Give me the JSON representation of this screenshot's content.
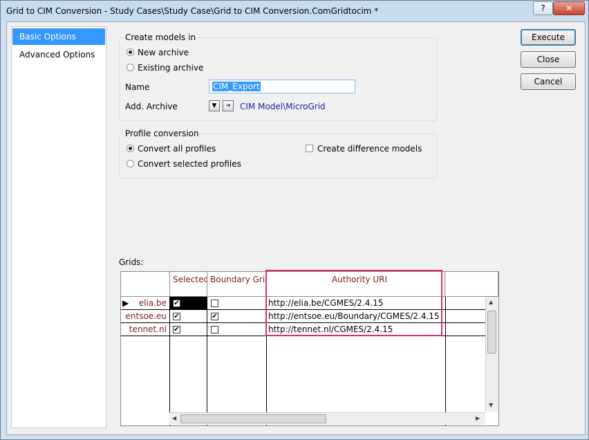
{
  "window": {
    "title": "Grid to CIM Conversion - Study Cases\\Study Case\\Grid to CIM Conversion.ComGridtocim *",
    "help_label": "?",
    "close_label": "✕"
  },
  "nav": {
    "items": [
      "Basic Options",
      "Advanced Options"
    ]
  },
  "create_models": {
    "legend": "Create models in",
    "new_archive": "New archive",
    "existing_archive": "Existing archive",
    "name_label": "Name",
    "name_value": "CIM_Export",
    "add_archive_label": "Add. Archive",
    "archive_link": "CIM Model\\MicroGrid"
  },
  "profile_conversion": {
    "legend": "Profile conversion",
    "convert_all": "Convert all profiles",
    "convert_selected": "Convert selected profiles",
    "create_difference": "Create difference models"
  },
  "buttons": {
    "execute": "Execute",
    "close": "Close",
    "cancel": "Cancel"
  },
  "grids": {
    "label": "Grids:",
    "columns": [
      "Selected",
      "Boundary Grid",
      "Authority URI"
    ],
    "rows": [
      {
        "name": "elia.be",
        "selected": true,
        "boundary": false,
        "uri": "http://elia.be/CGMES/2.4.15"
      },
      {
        "name": "entsoe.eu",
        "selected": true,
        "boundary": true,
        "uri": "http://entsoe.eu/Boundary/CGMES/2.4.15"
      },
      {
        "name": "tennet.nl",
        "selected": true,
        "boundary": false,
        "uri": "http://tennet.nl/CGMES/2.4.15"
      }
    ]
  },
  "colors": {
    "accent": "#3399ff",
    "highlight": "#e0287a",
    "grid_header_text": "#7b1c1c"
  }
}
